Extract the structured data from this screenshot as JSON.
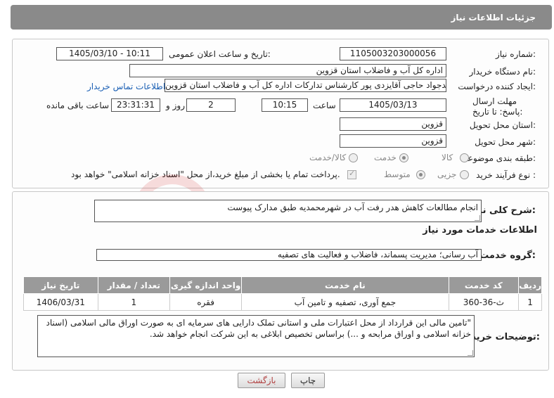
{
  "header": {
    "title": "جزئیات اطلاعات نیاز"
  },
  "form": {
    "need_number_label": "شماره نیاز:",
    "need_number": "1105003203000056",
    "announce_label": "تاریخ و ساعت اعلان عمومی:",
    "announce_value": "1405/03/10 - 10:11",
    "buyer_org_label": "نام دستگاه خریدار:",
    "buyer_org": "اداره کل آب و فاضلاب استان قزوین",
    "creator_label": "ایجاد کننده درخواست:",
    "creator": "محمدجواد حاجی آقایزدی پور کارشناس تدارکات اداره کل آب و فاضلاب استان قزوین",
    "contact_link": "اطلاعات تماس خریدار",
    "deadline_label": "مهلت ارسال پاسخ: تا تاریخ:",
    "deadline_date": "1405/03/13",
    "time_label": "ساعت",
    "deadline_time": "10:15",
    "days_value": "2",
    "days_label": "روز و",
    "remaining_value": "23:31:31",
    "remaining_label": "ساعت باقی مانده",
    "province_label": "استان محل تحویل:",
    "province": "قزوین",
    "city_label": "شهر محل تحویل:",
    "city": "قزوین",
    "category_label": "طبقه بندی موضوعی:",
    "category_options": [
      "کالا",
      "خدمت",
      "کالا/خدمت"
    ],
    "category_selected": "خدمت",
    "process_label": "نوع فرآیند خرید :",
    "process_options": [
      "جزیی",
      "متوسط"
    ],
    "process_selected": "متوسط",
    "payment_note": "پرداخت تمام یا بخشی از مبلغ خرید،از محل \"اسناد خزانه اسلامی\" خواهد بود."
  },
  "description": {
    "label": "شرح کلی نیاز:",
    "text": "انجام مطالعات کاهش هدر رفت آب در شهرمحمدیه طبق مدارک پیوست"
  },
  "services": {
    "section_title": "اطلاعات خدمات مورد نیاز",
    "group_label": "گروه خدمت:",
    "group_value": "آب رسانی؛ مدیریت پسماند، فاضلاب و فعالیت های تصفیه",
    "table": {
      "headers": [
        "ردیف",
        "کد خدمت",
        "نام خدمت",
        "واحد اندازه گیری",
        "تعداد / مقدار",
        "تاریخ نیاز"
      ],
      "rows": [
        [
          "1",
          "ث-36-360",
          "جمع آوری، تصفیه و تامین آب",
          "فقره",
          "1",
          "1406/03/31"
        ]
      ]
    }
  },
  "buyer_notes": {
    "label": "توضیحات خریدار:",
    "text": "\"تامین مالی این قرارداد از محل اعتبارات ملی و استانی تملک دارایی های سرمایه ای به صورت اوراق مالی اسلامی (اسناد خزانه اسلامی و اوراق مرابحه و ...) براساس تخصیص ابلاغی به این شرکت انجام خواهد شد."
  },
  "buttons": {
    "print": "چاپ",
    "back": "بازگشت"
  },
  "watermark": {
    "text": "AriaTender.net"
  }
}
